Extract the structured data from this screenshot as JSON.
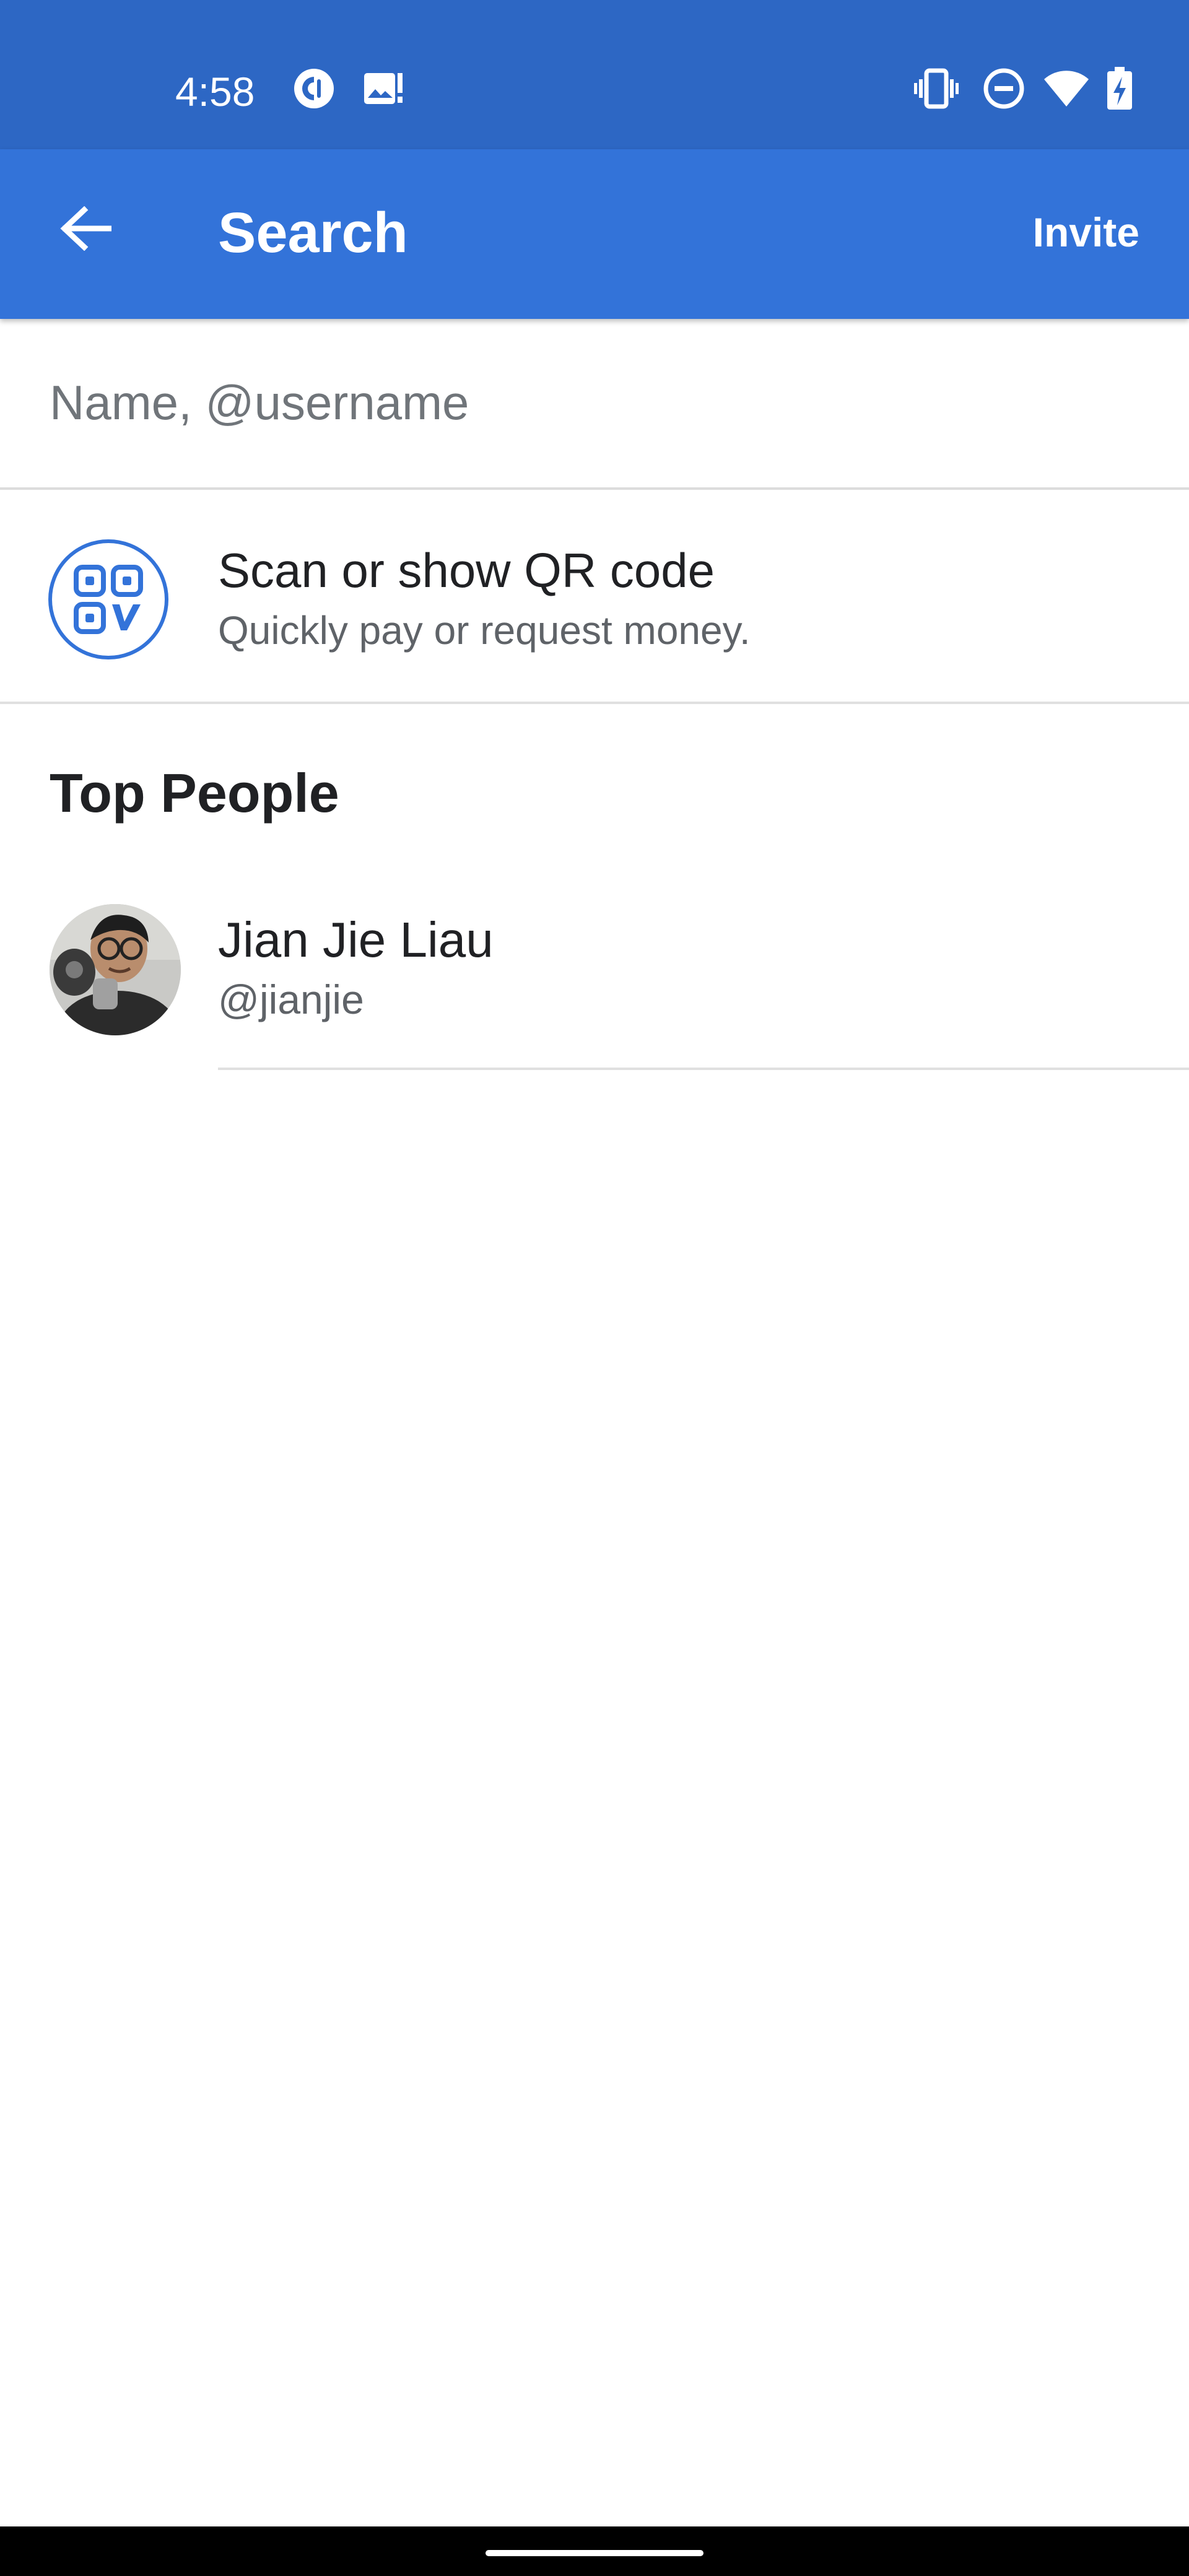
{
  "status_bar": {
    "time": "4:58",
    "left_icons": [
      "pocket-casts-icon",
      "image-notification-icon"
    ],
    "right_icons": [
      "vibrate-icon",
      "do-not-disturb-icon",
      "wifi-icon",
      "battery-charging-icon"
    ]
  },
  "app_bar": {
    "title": "Search",
    "invite_label": "Invite",
    "back_icon": "arrow-back-icon"
  },
  "search": {
    "placeholder": "Name, @username",
    "value": ""
  },
  "qr_item": {
    "title": "Scan or show QR code",
    "subtitle": "Quickly pay or request money.",
    "icon": "qr-code-icon"
  },
  "top_people": {
    "heading": "Top People",
    "people": [
      {
        "name": "Jian Jie Liau",
        "username": "@jianjie"
      }
    ]
  },
  "colors": {
    "status_bar": "#2d67c4",
    "app_bar": "#3373d9",
    "accent": "#3373d9",
    "text_primary": "#202124",
    "text_secondary": "#5f6368"
  }
}
